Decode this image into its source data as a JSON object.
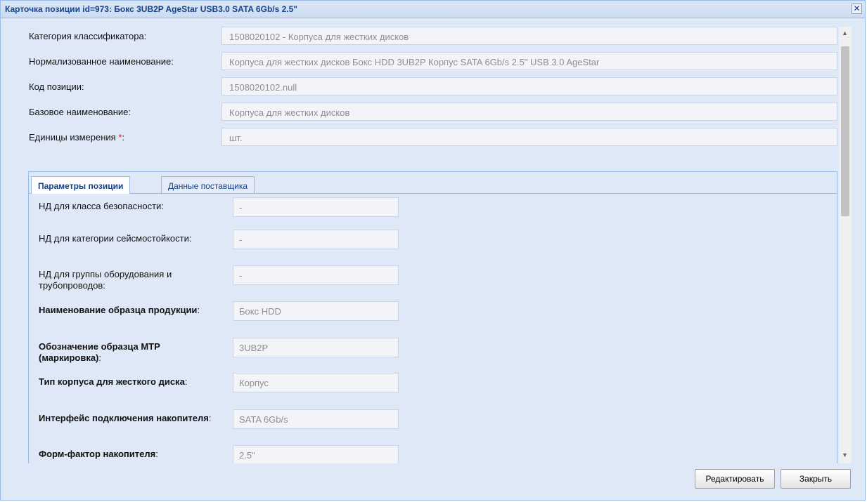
{
  "window": {
    "title": "Карточка позиции id=973: Бокс 3UB2P AgeStar USB3.0 SATA 6Gb/s 2.5\"",
    "close_icon": "close-icon"
  },
  "form": {
    "fields": [
      {
        "label": "Категория классификатора:",
        "value": "1508020102 - Корпуса для жестких дисков"
      },
      {
        "label": "Нормализованное наименование:",
        "value": "Корпуса для жестких дисков Бокс HDD 3UB2P Корпус SATA 6Gb/s 2.5\" USB 3.0 AgeStar"
      },
      {
        "label": "Код позиции:",
        "value": "1508020102.null"
      },
      {
        "label": "Базовое наименование:",
        "value": "Корпуса для жестких дисков"
      },
      {
        "label": "Единицы измерения",
        "required_mark": "*",
        "label_suffix": ":",
        "value": "шт."
      }
    ]
  },
  "tabs": [
    {
      "label": "Параметры позиции",
      "active": true
    },
    {
      "label": "Данные поставщика",
      "active": false
    }
  ],
  "params": [
    {
      "label": "НД для класса безопасности:",
      "value": "-",
      "bold": false
    },
    {
      "label": "НД для категории сейсмостойкости:",
      "value": "-",
      "bold": false
    },
    {
      "label": "НД для группы оборудования и трубопроводов:",
      "value": "-",
      "bold": false
    },
    {
      "label": "Наименование образца продукции",
      "suffix": ":",
      "value": "Бокс HDD",
      "bold": true
    },
    {
      "label": "Обозначение образца МТР (маркировка)",
      "suffix": ":",
      "value": "3UB2P",
      "bold": true
    },
    {
      "label": "Тип корпуса для жесткого диска",
      "suffix": ":",
      "value": "Корпус",
      "bold": true
    },
    {
      "label": "Интерфейс подключения накопителя",
      "suffix": ":",
      "value": "SATA 6Gb/s",
      "bold": true
    },
    {
      "label": "Форм-фактор накопителя",
      "suffix": ":",
      "value": "2.5\"",
      "bold": true
    }
  ],
  "buttons": {
    "edit": "Редактировать",
    "close": "Закрыть"
  },
  "scrollbar": {
    "up_icon": "scroll-up-icon",
    "down_icon": "scroll-down-icon"
  }
}
